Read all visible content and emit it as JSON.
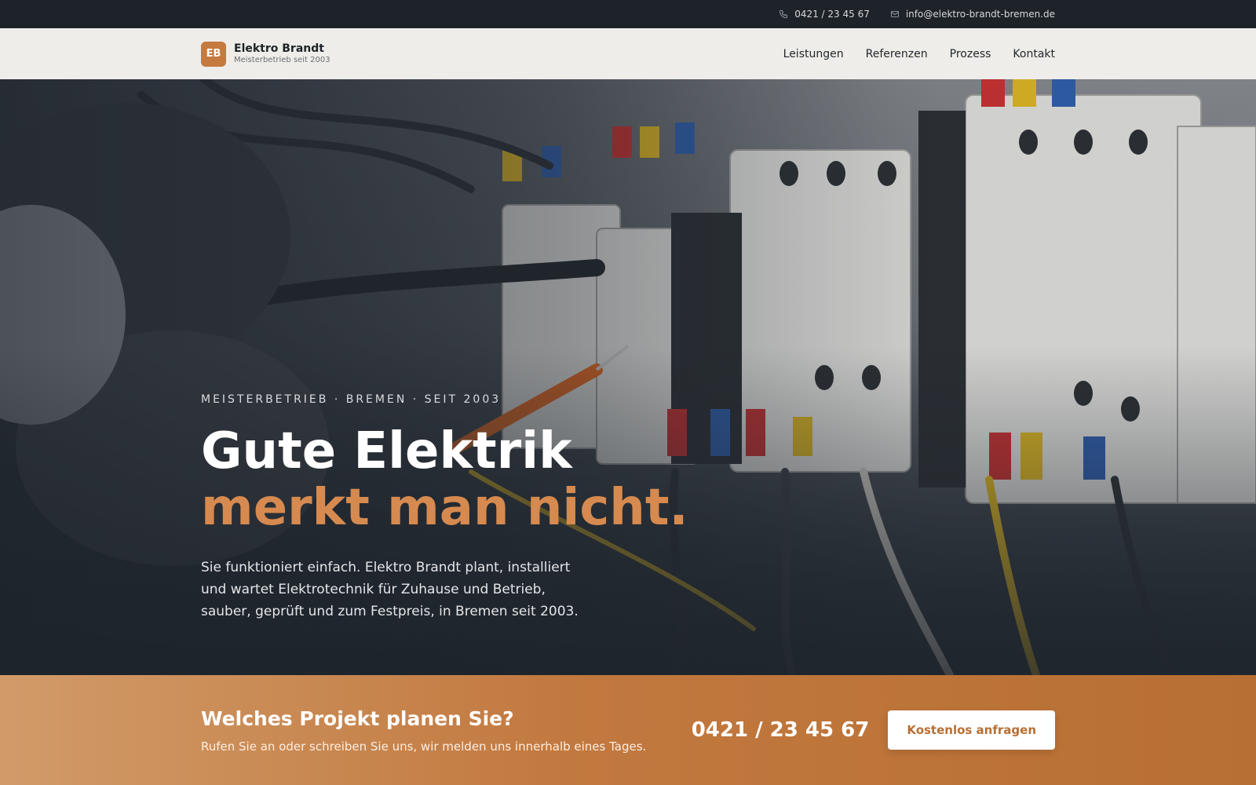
{
  "topbar": {
    "phone": "0421 / 23 45 67",
    "email": "info@elektro-brandt-bremen.de",
    "phone_icon": "phone-icon",
    "email_icon": "mail-icon"
  },
  "brand": {
    "logo_text": "EB",
    "name": "Elektro Brandt",
    "tagline": "Meisterbetrieb seit 2003"
  },
  "nav": {
    "items": [
      {
        "label": "Leistungen"
      },
      {
        "label": "Referenzen"
      },
      {
        "label": "Prozess"
      },
      {
        "label": "Kontakt"
      }
    ]
  },
  "hero": {
    "eyebrow": "MEISTERBETRIEB · BREMEN · SEIT 2003",
    "headline_part1": "Gute Elektrik ",
    "headline_part2": "merkt man nicht.",
    "lead": "Sie funktioniert einfach. Elektro Brandt plant, installiert und wartet Elektrotechnik für Zuhause und Betrieb, sauber, geprüft und zum Festpreis, in Bremen seit 2003."
  },
  "cta": {
    "title": "Welches Projekt planen Sie?",
    "subtitle": "Rufen Sie an oder schreiben Sie uns, wir melden uns innerhalb eines Tages.",
    "phone": "0421 / 23 45 67",
    "button_label": "Kostenlos anfragen"
  },
  "colors": {
    "accent": "#c57a3f",
    "dark": "#1e2329"
  }
}
